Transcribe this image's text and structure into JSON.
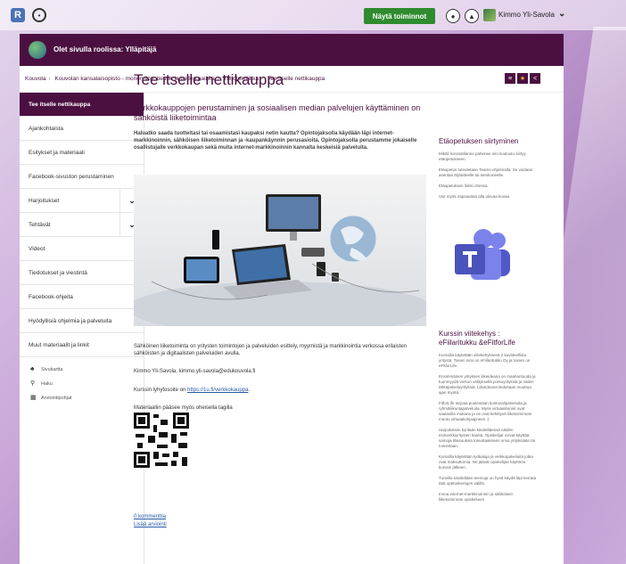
{
  "topbar": {
    "show_button": "Näytä toiminnot",
    "user_name": "Kimmo Yli-Savola"
  },
  "rolebar": {
    "text": "Olet sivulla roolissa: Ylläpitäjä"
  },
  "breadcrumb": [
    "Kouvola",
    "Kouvolan kansalaisopisto - monen ilon, tiedon ja taidon paikka",
    "Tietotekniikka",
    "Tee itselle nettikauppa"
  ],
  "sidebar": {
    "items": [
      {
        "label": "Tee itselle nettikauppa",
        "active": true,
        "has_chevron": false
      },
      {
        "label": "Ajankohtaista",
        "active": false,
        "has_chevron": false
      },
      {
        "label": "Esitykset ja materiaali",
        "active": false,
        "has_chevron": false
      },
      {
        "label": "Facebook-sivuston perustaminen",
        "active": false,
        "has_chevron": false
      },
      {
        "label": "Harjoitukset",
        "active": false,
        "has_chevron": true
      },
      {
        "label": "Tehtävät",
        "active": false,
        "has_chevron": true
      },
      {
        "label": "Videot",
        "active": false,
        "has_chevron": false
      },
      {
        "label": "Tiedotukset ja viestintä",
        "active": false,
        "has_chevron": false
      },
      {
        "label": "Facebook-ohjeita",
        "active": false,
        "has_chevron": false
      },
      {
        "label": "Hyödyllisiä ohjelmia ja palveluita",
        "active": false,
        "has_chevron": false
      },
      {
        "label": "Muut materiaalit ja linkit",
        "active": false,
        "has_chevron": false
      }
    ],
    "tools": [
      {
        "icon": "sitemap-icon",
        "label": "Sivukartta"
      },
      {
        "icon": "search-icon",
        "label": "Haku"
      },
      {
        "icon": "calendar-icon",
        "label": "Arviointipohjat"
      }
    ]
  },
  "main": {
    "title": "Tee itselle nettikauppa",
    "subtitle": "Verkkokauppojen perustaminen ja sosiaalisen median palvelujen käyttäminen on sähköistä liiketoimintaa",
    "lead": "Haluatko saada tuotteitasi tai osaamistasi kaupaksi netin kautta? Opintojaksolla käydään läpi internet-markkinoinnin, sähköisen liiketoiminnan ja -kaupankäynnin perusasioita. Opintojaksolla perustamme jokaiselle osallistujalle verkkokaupan sekä muita internet-markkinoinnin kannalta keskeisiä palveluita.",
    "paragraph": "Sähköinen liiketoiminta on yritysten toimintojen ja palveluiden esittely, myymistä ja markkinointia verkossa erilaisten sähköisten ja digitaalisten palveluiden avulla.",
    "contact": "Kimmo Yli-Savola, kimmo.yli-savola@edukouvola.fi",
    "short_link_label": "Kurssin lyhytosoite on ",
    "short_link": "https://1u.fi/verkkokauppa",
    "short_link_end": ".",
    "qr_label": "Materiaaliin pääsee myös oheisella tagilla",
    "comments_link": "0 kommenttia",
    "rating_link": "Lisää arviointi"
  },
  "right": {
    "section1_title": "Etäopetuksen siirtyminen",
    "section1_texts": [
      "Mikäli koronatilanne pahenee niin kouluutu siirtyy etäopetukseen.",
      "Etäopetus toteutetaan Teams-ohjelmalla. Se voidaan asentaa älylaitteelle tai tietokoneelle.",
      "Etäopetuksen linkki ohessa.",
      "Voit myös napsauttaa alla olevaa kuvaa"
    ],
    "section2_title": "Kurssin viitekehys : eFiilaritukku &eFitforLife",
    "section2_texts": [
      "Kurssilla käytetään viitekehyksenä 2 kuvitteellista yritystä. Toisen nimi on eFiilaritukku Oy ja toinen on eFitforLife.",
      "Ensimmäinen yrityksen liikeideana on maahantuoda ja tuonmyydä verkon välityksellä porkuyrityksiä ja niiden tähtäpalveluyrityksiä. Liikeideana lasketaan muuttua ajan myötä.",
      "FitforLife tarjoaa puolestaan kuntosalipalveluita ja ryhmäliikuntapalveluita. Myös virtuaalitunnit ovat saatavilla mukana ja ne ovat kehittyvä liiketoiminnan muoto virtuaaliohjaajineen :)",
      "Harjoituksiin kyritään käsiteltäessä näiden esimerkkiyritysten kautta. Opiskelijat voivat käyttää samoja tilaisuuksia toteuttaakseen omia yrityksiään tai toimintaan.",
      "Kurssilla käytetään työkaluja ja verkkopalveluita jotka ovat maksuttomia. Ne jäävät opiskelijan käyttöön kurssin jälkeen.",
      "Tunnilla käsitellään teemoja on hyvä käydä läpi kerrata tätä opetuskertojen välillä.",
      "Innoa internet-markkinoinnin ja sähköisen liiketoiminnan opiskeluun!"
    ]
  },
  "colors": {
    "brand": "#4b1040",
    "show_button": "#2e8b2e",
    "link": "#2a5aa8"
  }
}
